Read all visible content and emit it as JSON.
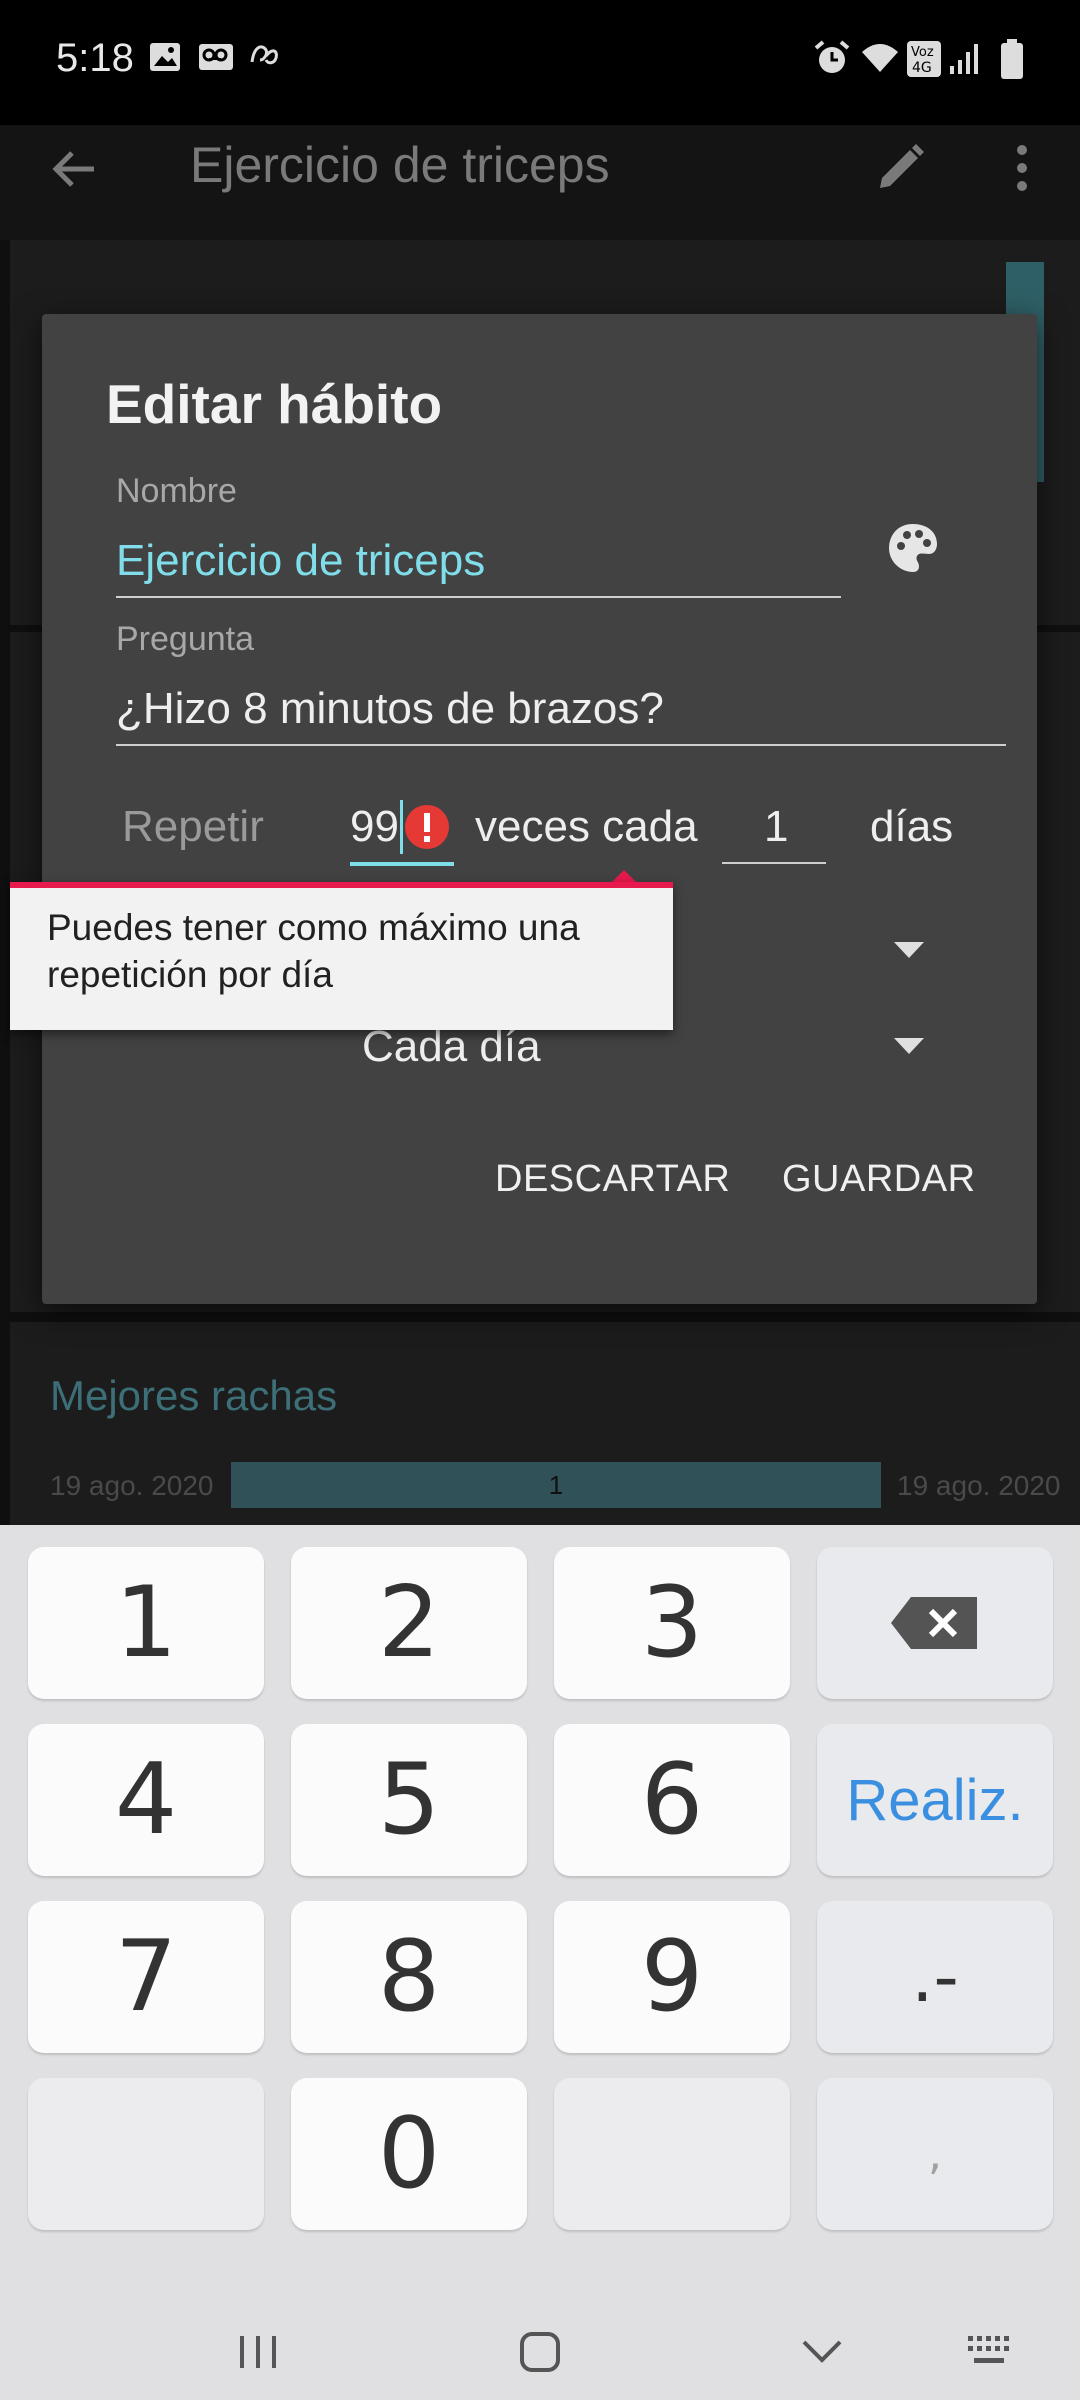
{
  "status_bar": {
    "time": "5:18"
  },
  "app_bar": {
    "title": "Ejercicio de triceps"
  },
  "background": {
    "section_title": "Mejores rachas",
    "streak_start": "19 ago. 2020",
    "streak_end": "19 ago. 2020",
    "streak_value": "1"
  },
  "dialog": {
    "title": "Editar hábito",
    "name_label": "Nombre",
    "name_value": "Ejercicio de triceps",
    "question_label": "Pregunta",
    "question_value": "¿Hizo 8 minutos de brazos?",
    "repeat_label": "Repetir",
    "repeat_value": "99",
    "times_text": "veces cada",
    "every_value": "1",
    "days_text": "días",
    "reminder_value": "Cada día",
    "error_tooltip": "Puedes tener como máximo una repetición por día",
    "discard_label": "DESCARTAR",
    "save_label": "GUARDAR"
  },
  "keyboard": {
    "rows": [
      [
        "1",
        "2",
        "3",
        ""
      ],
      [
        "4",
        "5",
        "6",
        "Realiz."
      ],
      [
        "7",
        "8",
        "9",
        ".-"
      ],
      [
        "",
        "0",
        "",
        ","
      ]
    ]
  },
  "colors": {
    "accent": "#80deea",
    "error": "#e8194d",
    "keyboard_done": "#3b8fe0"
  }
}
